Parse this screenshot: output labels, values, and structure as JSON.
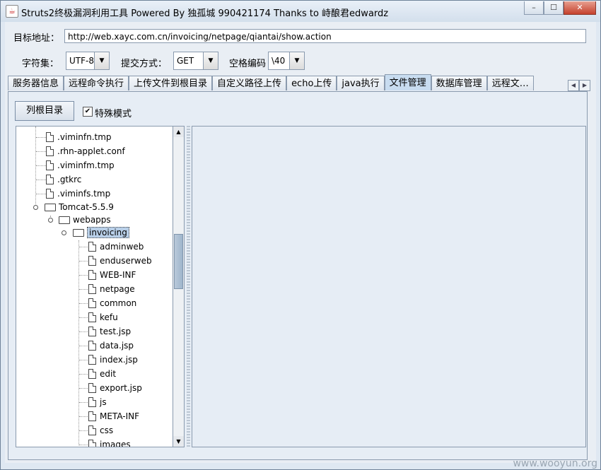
{
  "window": {
    "title": "Struts2终极漏洞利用工具  Powered By 独孤城 990421174 Thanks to 峙酿君edwardz",
    "controls": [
      "–",
      "☐",
      "✕"
    ]
  },
  "form": {
    "url_label": "目标地址：",
    "url_value": "http://web.xayc.com.cn/invoicing/netpage/qiantai/show.action",
    "charset_label": "字符集：",
    "charset_value": "UTF-8",
    "method_label": "提交方式：",
    "method_value": "GET",
    "space_label": "空格编码",
    "space_value": "\\40"
  },
  "tabs": [
    "服务器信息",
    "远程命令执行",
    "上传文件到根目录",
    "自定义路径上传",
    "echo上传",
    "java执行",
    "文件管理",
    "数据库管理",
    "远程文…"
  ],
  "active_tab": "文件管理",
  "toolbar": {
    "list_root_button": "列根目录",
    "special_mode_label": "特殊模式",
    "special_mode_checked": true
  },
  "tree": {
    "top_files": [
      ".viminfn.tmp",
      ".rhn-applet.conf",
      ".viminfm.tmp",
      ".gtkrc",
      ".viminfs.tmp"
    ],
    "tomcat": "Tomcat-5.5.9",
    "webapps": "webapps",
    "invoicing": "invoicing",
    "children": [
      "adminweb",
      "enduserweb",
      "WEB-INF",
      "netpage",
      "common",
      "kefu",
      "test.jsp",
      "data.jsp",
      "index.jsp",
      "edit",
      "export.jsp",
      "js",
      "META-INF",
      "css",
      "images"
    ]
  },
  "watermark": "www.wooyun.org"
}
